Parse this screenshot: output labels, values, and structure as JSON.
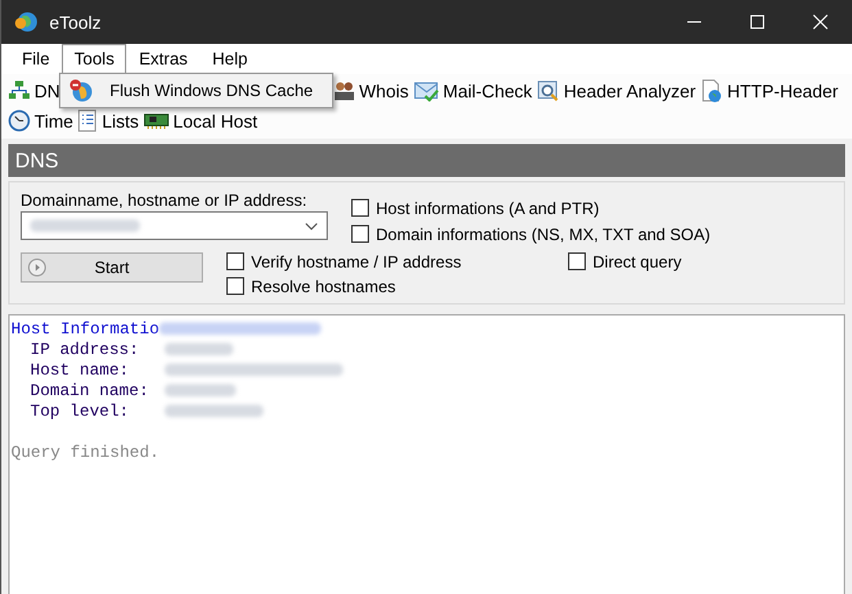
{
  "window": {
    "title": "eToolz"
  },
  "menu": [
    {
      "label": "File",
      "selected": false
    },
    {
      "label": "Tools",
      "selected": true
    },
    {
      "label": "Extras",
      "selected": false
    },
    {
      "label": "Help",
      "selected": false
    }
  ],
  "dropdown": {
    "items": [
      {
        "label": "Flush Windows DNS Cache"
      }
    ]
  },
  "toolbar_rows": [
    [
      {
        "label": "DN"
      },
      {
        "label": "Whois"
      },
      {
        "label": "Mail-Check"
      },
      {
        "label": "Header Analyzer"
      },
      {
        "label": "HTTP-Header"
      }
    ],
    [
      {
        "label": "Time"
      },
      {
        "label": "Lists"
      },
      {
        "label": "Local Host"
      }
    ]
  ],
  "section": {
    "title": "DNS"
  },
  "query": {
    "label": "Domainname, hostname or IP address:",
    "start_button": "Start"
  },
  "options": [
    {
      "label": "Host informations (A and PTR)",
      "checked": false
    },
    {
      "label": "Domain informations (NS, MX, TXT and SOA)",
      "checked": false
    },
    {
      "label": "Verify hostname / IP address",
      "checked": false
    },
    {
      "label": "Resolve hostnames",
      "checked": false
    },
    {
      "label": "Direct query",
      "checked": false
    }
  ],
  "output": {
    "heading": "Host Informatio",
    "fields": [
      "IP address:",
      "Host name:",
      "Domain name:",
      "Top level:"
    ],
    "status": "Query finished."
  }
}
